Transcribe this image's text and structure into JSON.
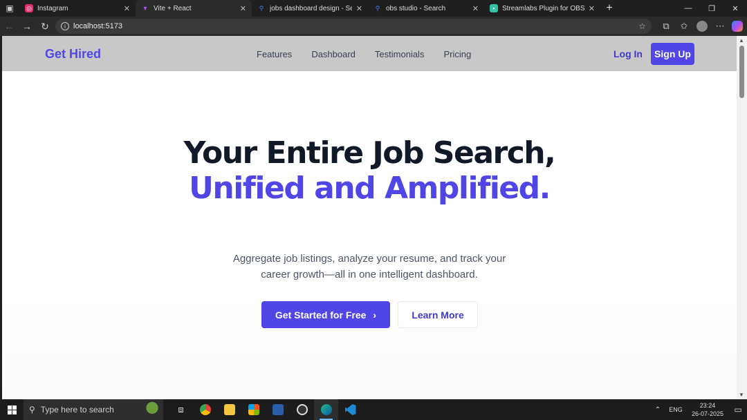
{
  "browser": {
    "tabs": [
      {
        "title": "Instagram",
        "icon": "instagram-icon",
        "color": "#e1306c"
      },
      {
        "title": "Vite + React",
        "icon": "vite-icon",
        "color": "#a855f7"
      },
      {
        "title": "jobs dashboard design - Search",
        "icon": "search-icon",
        "color": "#3b82f6"
      },
      {
        "title": "obs studio - Search",
        "icon": "search-icon",
        "color": "#3b82f6"
      },
      {
        "title": "Streamlabs Plugin for OBS | Add Al",
        "icon": "streamlabs-icon",
        "color": "#31c3a2"
      }
    ],
    "active_tab": 1,
    "url": "localhost:5173"
  },
  "site": {
    "logo": "Get Hired",
    "nav_links": [
      "Features",
      "Dashboard",
      "Testimonials",
      "Pricing"
    ],
    "login": "Log In",
    "signup": "Sign Up",
    "hero": {
      "line1": "Your Entire Job Search,",
      "line2": "Unified and Amplified.",
      "subtitle": "Aggregate job listings, analyze your resume, and track your career growth—all in one intelligent dashboard.",
      "cta_primary": "Get Started for Free",
      "cta_secondary": "Learn More"
    },
    "colors": {
      "accent": "#4f46e5",
      "heading": "#111827",
      "nav_bg": "#c8c8c8"
    }
  },
  "taskbar": {
    "search_placeholder": "Type here to search",
    "language": "ENG",
    "time": "23:24",
    "date": "26-07-2025"
  }
}
